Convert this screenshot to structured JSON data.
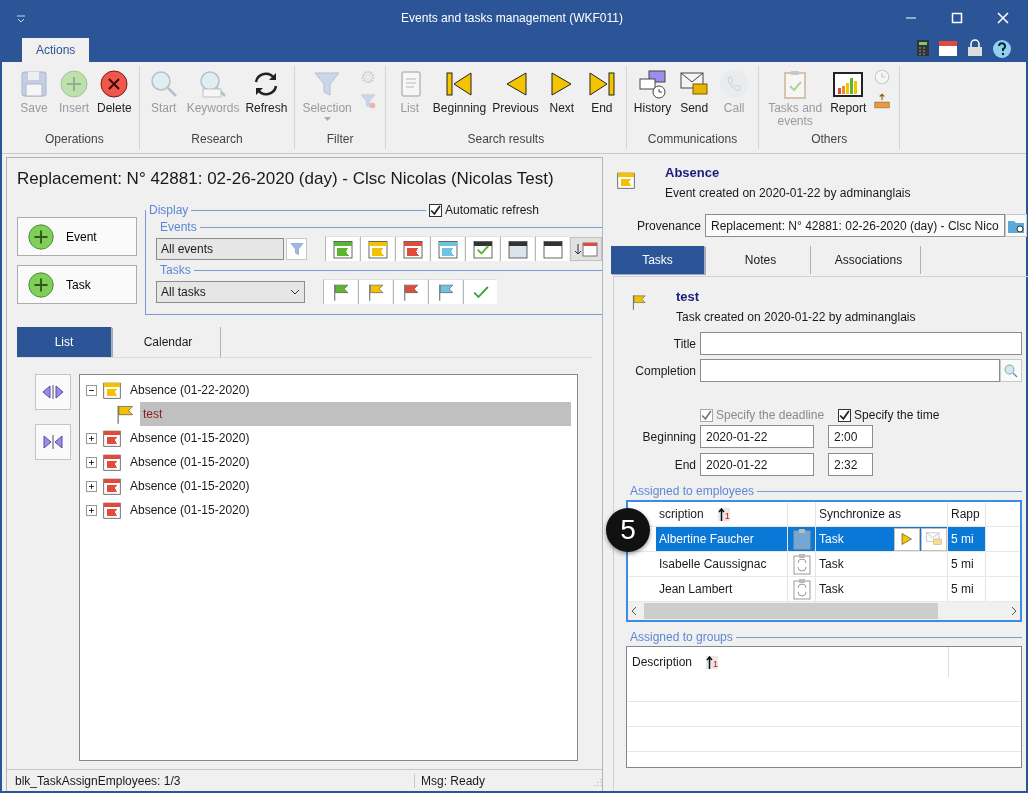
{
  "window": {
    "title": "Events and tasks management (WKF011)"
  },
  "ribbon": {
    "tabs": [
      {
        "label": "Actions",
        "selected": true
      }
    ],
    "groups": [
      {
        "label": "Operations",
        "buttons": [
          {
            "kind": "save",
            "label": "Save",
            "disabled": true
          },
          {
            "kind": "insert",
            "label": "Insert",
            "disabled": true
          },
          {
            "kind": "delete",
            "label": "Delete",
            "disabled": false
          }
        ]
      },
      {
        "label": "Research",
        "buttons": [
          {
            "kind": "search",
            "label": "Start",
            "disabled": true
          },
          {
            "kind": "keywords",
            "label": "Keywords",
            "disabled": true
          },
          {
            "kind": "refresh",
            "label": "Refresh",
            "disabled": false
          }
        ]
      },
      {
        "label": "Filter",
        "buttons": [
          {
            "kind": "filter",
            "label": "Selection",
            "disabled": true,
            "dropdown": true
          },
          {
            "kind": "stack",
            "icons": [
              {
                "kind": "gear",
                "disabled": true
              },
              {
                "kind": "filter-remove",
                "disabled": true
              }
            ]
          }
        ]
      },
      {
        "label": "Search results",
        "buttons": [
          {
            "kind": "list",
            "label": "List",
            "disabled": true
          },
          {
            "kind": "first",
            "label": "Beginning",
            "disabled": false
          },
          {
            "kind": "prev",
            "label": "Previous",
            "disabled": false
          },
          {
            "kind": "next",
            "label": "Next",
            "disabled": false
          },
          {
            "kind": "last",
            "label": "End",
            "disabled": false
          }
        ]
      },
      {
        "label": "Communications",
        "buttons": [
          {
            "kind": "history",
            "label": "History",
            "disabled": false
          },
          {
            "kind": "send",
            "label": "Send",
            "disabled": false
          },
          {
            "kind": "call",
            "label": "Call",
            "disabled": true
          }
        ]
      },
      {
        "label": "Others",
        "buttons": [
          {
            "kind": "clipboard",
            "label": "Tasks and events",
            "disabled": true
          },
          {
            "kind": "report",
            "label": "Report",
            "disabled": false
          },
          {
            "kind": "stack",
            "icons": [
              {
                "kind": "clock",
                "disabled": true
              },
              {
                "kind": "tray",
                "disabled": false
              }
            ]
          }
        ]
      }
    ]
  },
  "left": {
    "title": "Replacement: N° 42881: 02-26-2020 (day) - Clsc Nicolas (Nicolas Test)",
    "add_buttons": [
      "Event",
      "Task"
    ],
    "display": {
      "legend": "Display",
      "auto_refresh": {
        "label": "Automatic refresh",
        "checked": true
      },
      "events": {
        "legend": "Events",
        "value": "All events",
        "toggles": [
          {
            "kind": "calendar-flag",
            "color": "#5cb531"
          },
          {
            "kind": "calendar-flag",
            "color": "#f2c200"
          },
          {
            "kind": "calendar-flag",
            "color": "#e04b3c"
          },
          {
            "kind": "calendar-flag",
            "color": "#6cc3e6"
          },
          {
            "kind": "calendar-check"
          },
          {
            "kind": "calendar-open"
          },
          {
            "kind": "calendar"
          }
        ]
      },
      "tasks": {
        "legend": "Tasks",
        "value": "All tasks",
        "toggles": [
          {
            "kind": "flag",
            "color": "#5cb531"
          },
          {
            "kind": "flag",
            "color": "#f2c200"
          },
          {
            "kind": "flag",
            "color": "#e04b3c"
          },
          {
            "kind": "flag",
            "color": "#6cc3e6"
          },
          {
            "kind": "check"
          }
        ]
      }
    },
    "tabs": [
      {
        "label": "List",
        "selected": true
      },
      {
        "label": "Calendar",
        "selected": false
      }
    ],
    "tree": [
      {
        "label": "Absence (01-22-2020)",
        "color": "#f2c200",
        "expanded": true,
        "selected": false,
        "children": [
          {
            "label": "test",
            "selected": true
          }
        ]
      },
      {
        "label": "Absence (01-15-2020)",
        "color": "#e04b3c",
        "expanded": false,
        "selected": false
      },
      {
        "label": "Absence (01-15-2020)",
        "color": "#e04b3c",
        "expanded": false,
        "selected": false
      },
      {
        "label": "Absence (01-15-2020)",
        "color": "#e04b3c",
        "expanded": false,
        "selected": false
      },
      {
        "label": "Absence (01-15-2020)",
        "color": "#e04b3c",
        "expanded": false,
        "selected": false
      }
    ],
    "status": [
      "blk_TaskAssignEmployees: 1/3",
      "Msg: Ready"
    ]
  },
  "right": {
    "event_title": "Absence",
    "event_subtitle": "Event created on 2020-01-22 by adminanglais",
    "provenance": {
      "label": "Provenance",
      "value": "Replacement: N° 42881: 02-26-2020 (day) - Clsc Nico"
    },
    "tabs": [
      {
        "label": "Tasks",
        "selected": true
      },
      {
        "label": "Notes",
        "selected": false
      },
      {
        "label": "Associations",
        "selected": false
      }
    ],
    "task_title": "test",
    "task_subtitle": "Task created on 2020-01-22 by adminanglais",
    "title_field": {
      "label": "Title"
    },
    "completion_field": {
      "label": "Completion"
    },
    "specify_deadline": {
      "label": "Specify the deadline",
      "checked": true,
      "disabled": true
    },
    "specify_time": {
      "label": "Specify the time",
      "checked": true,
      "disabled": false
    },
    "beginning": {
      "label": "Beginning",
      "date": "2020-01-22",
      "time": "2:00"
    },
    "end": {
      "label": "End",
      "date": "2020-01-22",
      "time": "2:32"
    },
    "employees": {
      "legend": "Assigned to employees",
      "columns": [
        {
          "label": "scription",
          "sort_rank": "1"
        },
        {
          "label": "Synchronize as"
        },
        {
          "label": "Rapp"
        }
      ],
      "rows": [
        {
          "name": "Albertine Faucher",
          "sync": "Task",
          "reminder": "5 mi",
          "selected": true
        },
        {
          "name": "Isabelle Caussignac",
          "sync": "Task",
          "reminder": "5 mi",
          "selected": false
        },
        {
          "name": "Jean Lambert",
          "sync": "Task",
          "reminder": "5 mi",
          "selected": false
        }
      ]
    },
    "groups": {
      "legend": "Assigned to groups",
      "columns": [
        {
          "label": "Description",
          "sort_rank": "1"
        }
      ]
    }
  },
  "callout": {
    "label": "5"
  }
}
